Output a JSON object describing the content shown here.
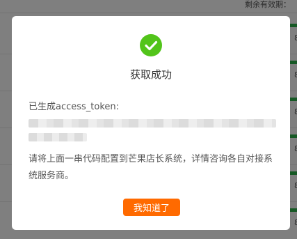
{
  "background": {
    "header_text": "剩余有效期：",
    "row_digits": [
      "8",
      "8",
      "8",
      "8",
      "8",
      "8"
    ]
  },
  "modal": {
    "icon": "success-check-icon",
    "title": "获取成功",
    "generated_label": "已生成access_token:",
    "token_value": "(redacted)",
    "instruction": "请将上面一串代码配置到芒果店长系统，详情咨询各自对接系统服务商。",
    "ok_button": "我知道了"
  },
  "colors": {
    "success_green": "#52c41a",
    "button_orange": "#ff6a00",
    "overlay": "rgba(0,0,0,0.5)"
  }
}
